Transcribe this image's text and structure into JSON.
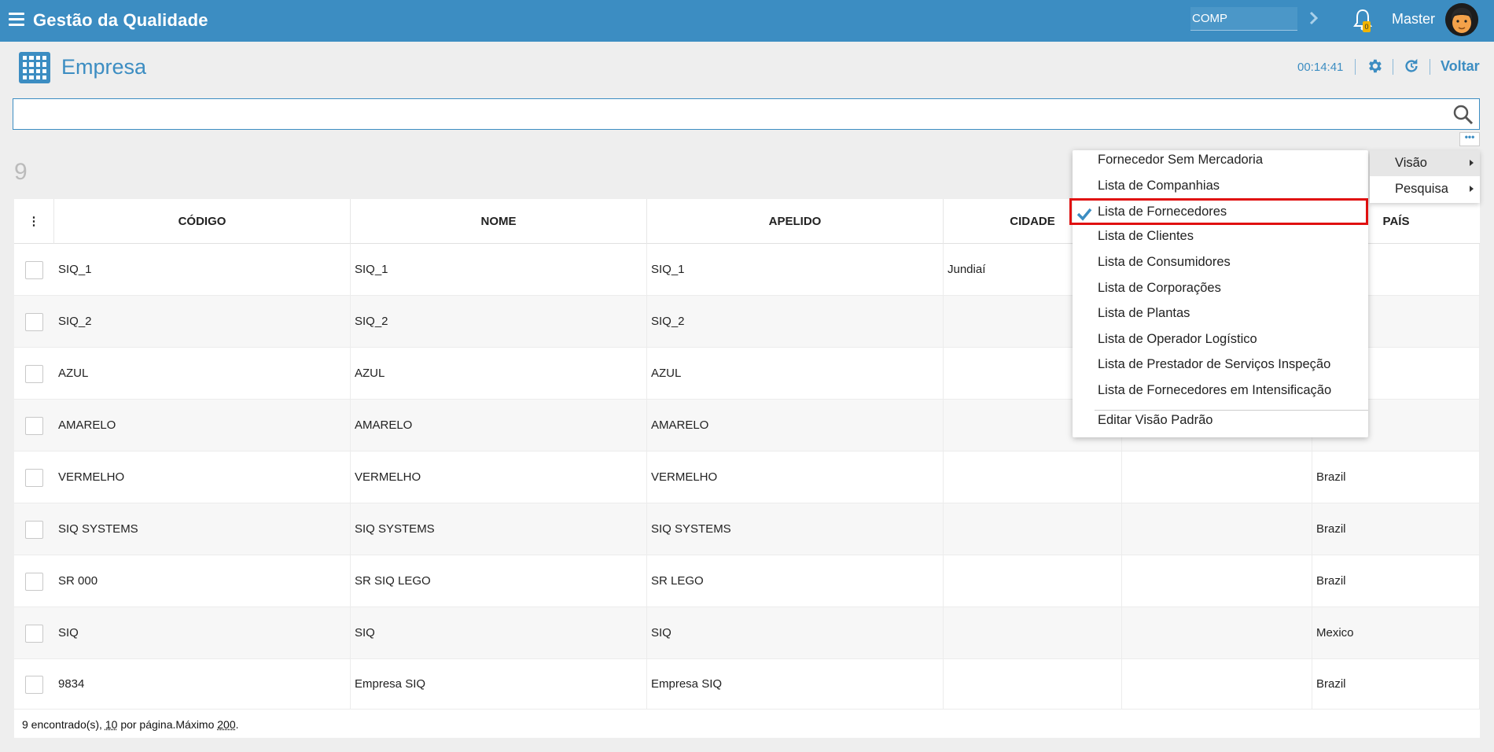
{
  "header": {
    "app_title": "Gestão da Qualidade",
    "company_field": "COMP",
    "notification_count": "0",
    "user_name": "Master"
  },
  "page": {
    "title": "Empresa",
    "timer": "00:14:41",
    "back_label": "Voltar"
  },
  "search": {
    "value": "",
    "placeholder": ""
  },
  "results_count": "9",
  "table": {
    "columns": [
      "CÓDIGO",
      "NOME",
      "APELIDO",
      "CIDADE",
      "",
      "PAÍS"
    ],
    "rows": [
      {
        "codigo": "SIQ_1",
        "nome": "SIQ_1",
        "apelido": "SIQ_1",
        "cidade": "Jundiaí",
        "pais": ""
      },
      {
        "codigo": "SIQ_2",
        "nome": "SIQ_2",
        "apelido": "SIQ_2",
        "cidade": "",
        "pais": ""
      },
      {
        "codigo": "AZUL",
        "nome": "AZUL",
        "apelido": "AZUL",
        "cidade": "",
        "pais": ""
      },
      {
        "codigo": "AMARELO",
        "nome": "AMARELO",
        "apelido": "AMARELO",
        "cidade": "",
        "pais": ""
      },
      {
        "codigo": "VERMELHO",
        "nome": "VERMELHO",
        "apelido": "VERMELHO",
        "cidade": "",
        "pais": "Brazil"
      },
      {
        "codigo": "SIQ SYSTEMS",
        "nome": "SIQ SYSTEMS",
        "apelido": "SIQ SYSTEMS",
        "cidade": "",
        "pais": "Brazil"
      },
      {
        "codigo": "SR 000",
        "nome": "SR SIQ LEGO",
        "apelido": "SR LEGO",
        "cidade": "",
        "pais": "Brazil"
      },
      {
        "codigo": "SIQ",
        "nome": "SIQ",
        "apelido": "SIQ",
        "cidade": "",
        "pais": "Mexico"
      },
      {
        "codigo": "9834",
        "nome": "Empresa SIQ",
        "apelido": "Empresa SIQ",
        "cidade": "",
        "pais": "Brazil"
      }
    ]
  },
  "footer": {
    "found_text": "9 encontrado(s),",
    "per_page": "10",
    "per_page_text": "por página.Máximo",
    "max": "200",
    "end": "."
  },
  "menu": {
    "visao_items": [
      "Fornecedor Sem Mercadoria",
      "Lista de Companhias",
      "Lista de Fornecedores",
      "Lista de Clientes",
      "Lista de Consumidores",
      "Lista de Corporações",
      "Lista de Plantas",
      "Lista de Operador Logístico",
      "Lista de Prestador de Serviços Inspeção",
      "Lista de Fornecedores em Intensificação"
    ],
    "selected_item": "Lista de Fornecedores",
    "edit_default": "Editar Visão Padrão",
    "submenu": [
      "Visão",
      "Pesquisa"
    ]
  },
  "colors": {
    "primary": "#3c8dc2",
    "highlight_border": "#e01010"
  }
}
